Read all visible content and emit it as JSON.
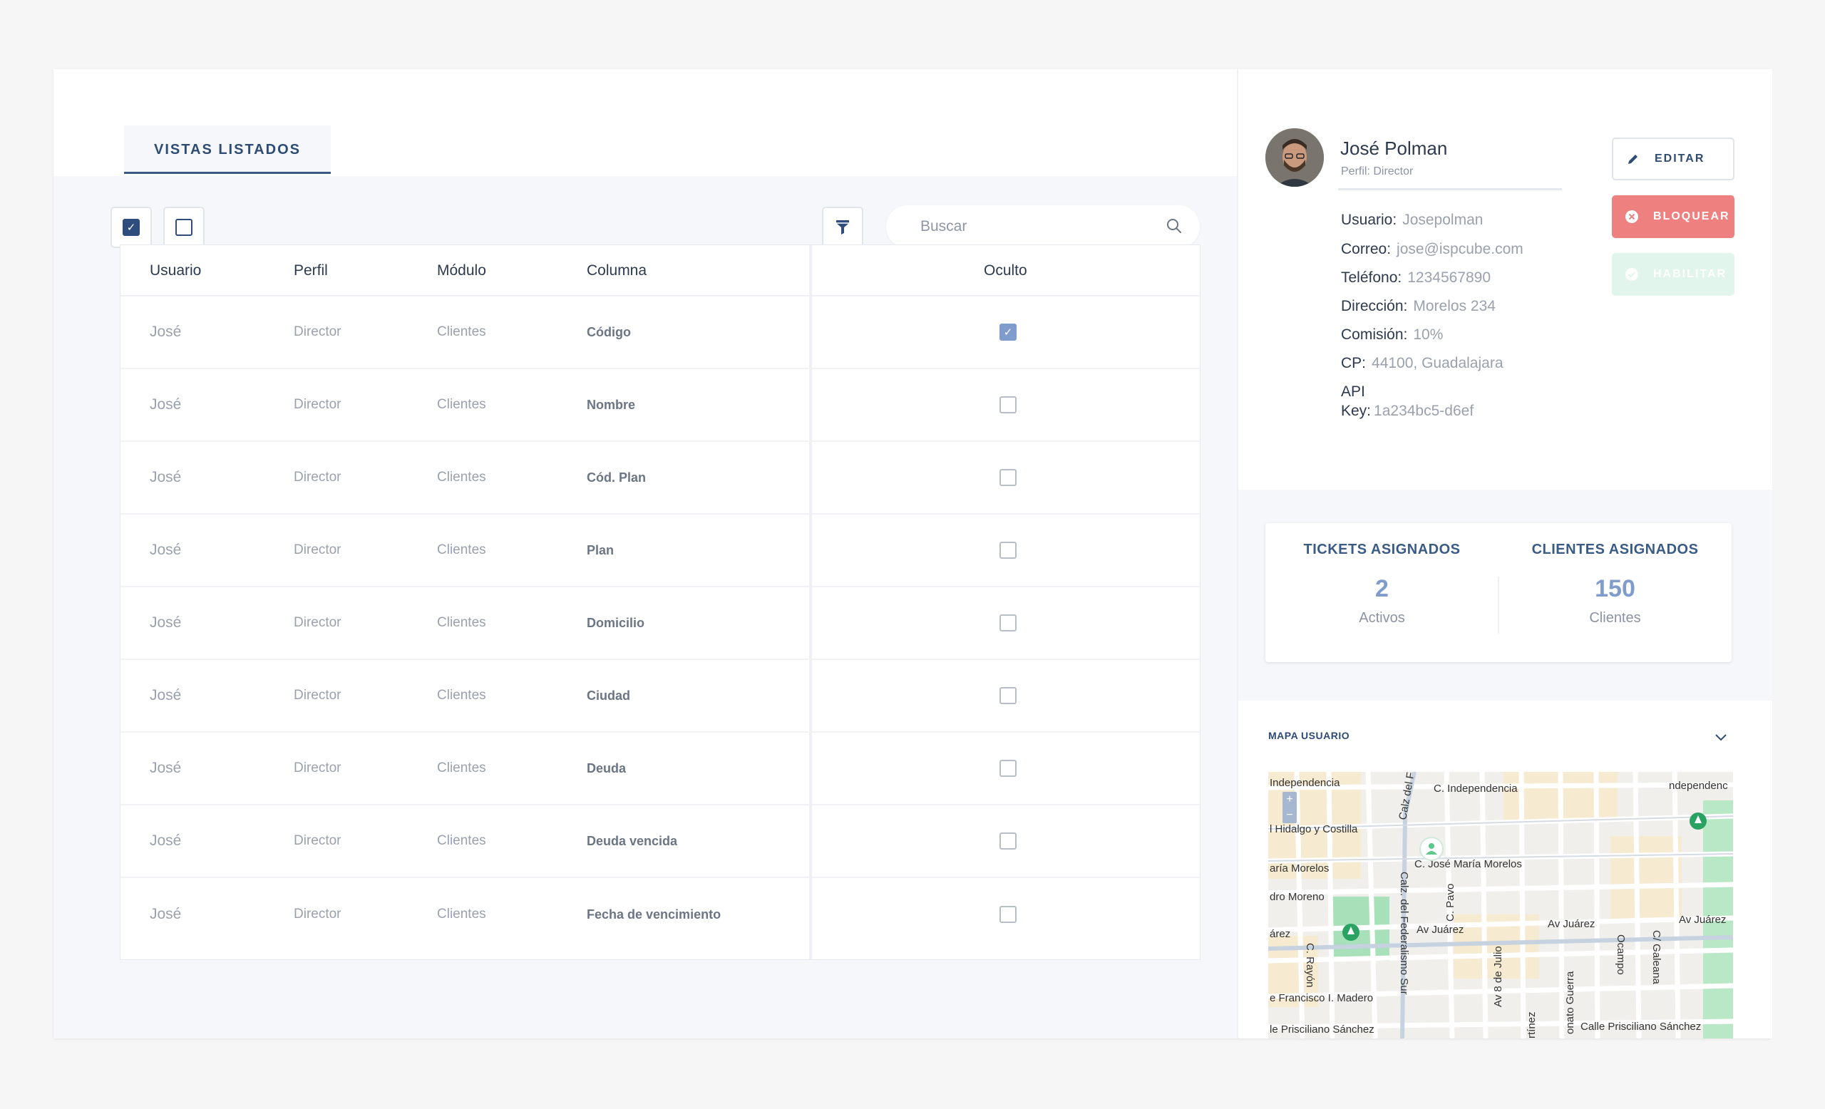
{
  "tab": {
    "label": "VISTAS LISTADOS"
  },
  "toolbar": {
    "select_all_checked": true,
    "select_none_checked": false,
    "filter_icon": "funnel-icon"
  },
  "search": {
    "placeholder": "Buscar",
    "value": "",
    "icon": "search-icon"
  },
  "table": {
    "headers": {
      "usuario": "Usuario",
      "perfil": "Perfil",
      "modulo": "Módulo",
      "columna": "Columna",
      "oculto": "Oculto"
    },
    "rows": [
      {
        "usuario": "José",
        "perfil": "Director",
        "modulo": "Clientes",
        "columna": "Código",
        "oculto": true
      },
      {
        "usuario": "José",
        "perfil": "Director",
        "modulo": "Clientes",
        "columna": "Nombre",
        "oculto": false
      },
      {
        "usuario": "José",
        "perfil": "Director",
        "modulo": "Clientes",
        "columna": "Cód. Plan",
        "oculto": false
      },
      {
        "usuario": "José",
        "perfil": "Director",
        "modulo": "Clientes",
        "columna": "Plan",
        "oculto": false
      },
      {
        "usuario": "José",
        "perfil": "Director",
        "modulo": "Clientes",
        "columna": "Domicilio",
        "oculto": false
      },
      {
        "usuario": "José",
        "perfil": "Director",
        "modulo": "Clientes",
        "columna": "Ciudad",
        "oculto": false
      },
      {
        "usuario": "José",
        "perfil": "Director",
        "modulo": "Clientes",
        "columna": "Deuda",
        "oculto": false
      },
      {
        "usuario": "José",
        "perfil": "Director",
        "modulo": "Clientes",
        "columna": "Deuda vencida",
        "oculto": false
      },
      {
        "usuario": "José",
        "perfil": "Director",
        "modulo": "Clientes",
        "columna": "Fecha de vencimiento",
        "oculto": false
      }
    ]
  },
  "profile": {
    "name": "José Polman",
    "role": "Perfil: Director",
    "fields": {
      "usuario": {
        "label": "Usuario:",
        "value": "Josepolman"
      },
      "correo": {
        "label": "Correo:",
        "value": "jose@ispcube.com"
      },
      "telefono": {
        "label": "Teléfono:",
        "value": "1234567890"
      },
      "direccion": {
        "label": "Dirección:",
        "value": "Morelos 234"
      },
      "comision": {
        "label": "Comisión:",
        "value": "10%"
      },
      "cp": {
        "label": "CP:",
        "value": "44100, Guadalajara"
      },
      "api": {
        "label_line1": "API",
        "label_line2": "Key:",
        "value": "1a234bc5-d6ef"
      }
    },
    "buttons": {
      "edit": "EDITAR",
      "block": "BLOQUEAR",
      "enable": "HABILITAR"
    }
  },
  "stats": {
    "tickets": {
      "title": "TICKETS ASIGNADOS",
      "value": "2",
      "sub": "Activos"
    },
    "clients": {
      "title": "CLIENTES ASIGNADOS",
      "value": "150",
      "sub": "Clientes"
    }
  },
  "map": {
    "title": "MAPA USUARIO",
    "zoom_in": "+",
    "zoom_out": "−",
    "labels": {
      "independencia_w": "Independencia",
      "independencia_c": "C. Independencia",
      "independencia_e": "ndependenc",
      "hidalgo": "l Hidalgo y Costilla",
      "morelos_w": "aría Morelos",
      "morelos_c": "C. José María Morelos",
      "moreno": "dro Moreno",
      "juarez_w": "árez",
      "juarez_c": "Av Juárez",
      "juarez_e1": "Av Juárez",
      "juarez_e2": "Av Juárez",
      "madero": "e Francisco I. Madero",
      "sanchez_w": "le Prisciliano Sánchez",
      "sanchez_e": "Calle Prisciliano Sánchez",
      "federalismo": "Calz. del Federalismo Sur",
      "calz_top": "Calz del F",
      "pavo": "C. Pavo",
      "rayon": "C. Rayón",
      "julio": "Av 8 de Julio",
      "guerra": "onato Guerra",
      "ocampo": "Ocampo",
      "galeana": "C/ Galeana",
      "martinez": "rtínez"
    }
  }
}
